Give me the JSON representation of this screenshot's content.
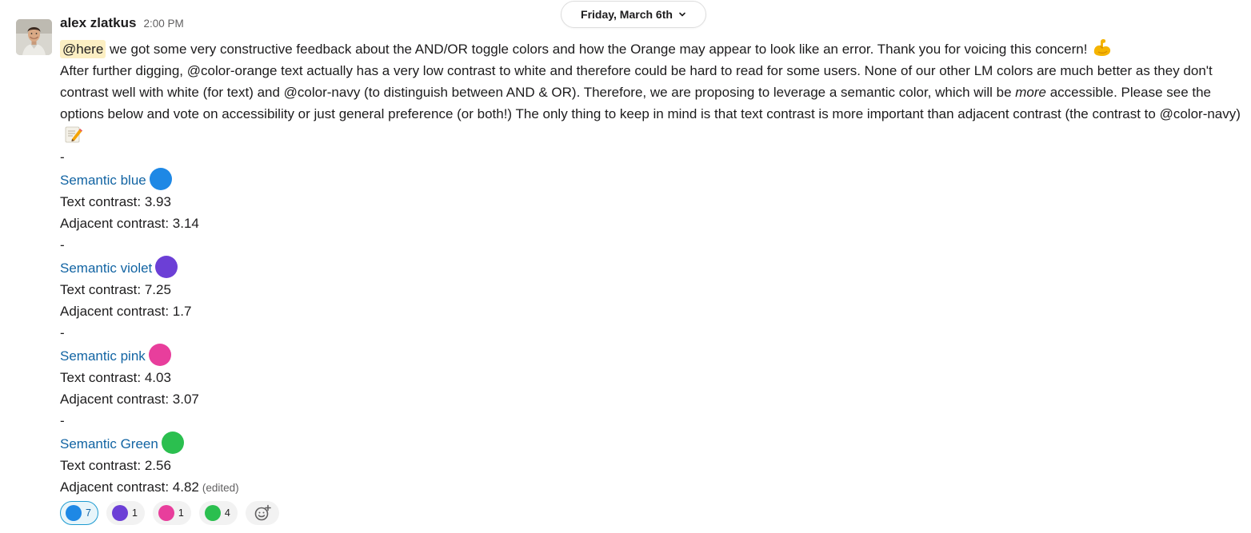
{
  "date_divider": {
    "label": "Friday, March 6th",
    "icon": "chevron-down-icon"
  },
  "message": {
    "sender": "alex zlatkus",
    "timestamp": "2:00 PM",
    "mention": "@here",
    "line1_text": "we got some very constructive feedback about the AND/OR toggle colors and how the Orange may appear to look like an error. Thank you for voicing this concern!",
    "line1_emoji": "muscle-emoji",
    "para_part1": "After further digging, @color-orange text actually has a very low contrast to white and therefore could be hard to read for some users. None of our other LM colors are much better as they don't contrast well with white (for text) and @color-navy (to distinguish between AND & OR). Therefore, we are proposing to leverage a semantic color, which will be ",
    "para_emphasis": "more",
    "para_part2": " accessible. Please see the options below and vote on accessibility or just general preference (or both!) The only thing to keep in mind is that text contrast is more important than adjacent contrast (the contrast to @color-navy)",
    "para_emoji": "pencil-memo-emoji",
    "separator": "-",
    "options": [
      {
        "name": "Semantic blue",
        "color": "#1e88e5",
        "text_contrast": "Text contrast: 3.93",
        "adjacent_contrast": "Adjacent contrast: 3.14"
      },
      {
        "name": "Semantic violet",
        "color": "#6c3fd6",
        "text_contrast": "Text contrast: 7.25",
        "adjacent_contrast": "Adjacent contrast: 1.7"
      },
      {
        "name": "Semantic pink",
        "color": "#e83e9c",
        "text_contrast": "Text contrast: 4.03",
        "adjacent_contrast": "Adjacent contrast: 3.07"
      },
      {
        "name": "Semantic Green",
        "color": "#2bbf4f",
        "text_contrast": "Text contrast: 2.56",
        "adjacent_contrast": "Adjacent contrast: 4.82"
      }
    ],
    "edited_label": "(edited)"
  },
  "reactions": [
    {
      "emoji": "blue-circle",
      "color": "#1e88e5",
      "count": "7",
      "active": true
    },
    {
      "emoji": "violet-circle",
      "color": "#6c3fd6",
      "count": "1",
      "active": false
    },
    {
      "emoji": "pink-circle",
      "color": "#e83e9c",
      "count": "1",
      "active": false
    },
    {
      "emoji": "green-circle",
      "color": "#2bbf4f",
      "count": "4",
      "active": false
    }
  ],
  "add_reaction_icon": "add-reaction-icon",
  "colors": {
    "link": "#1264a3",
    "mention_bg": "#fcefc3",
    "active_reaction_border": "#1d9bd1"
  }
}
